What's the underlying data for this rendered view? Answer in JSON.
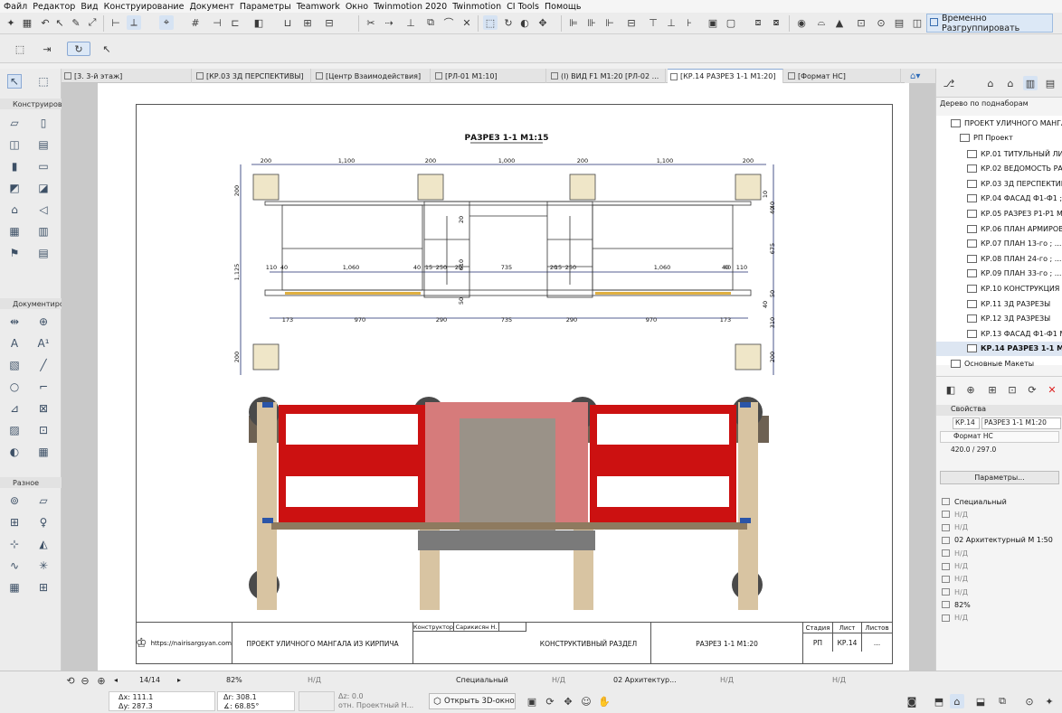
{
  "menubar": {
    "items": [
      "Файл",
      "Редактор",
      "Вид",
      "Конструирование",
      "Документ",
      "Параметры",
      "Teamwork",
      "Окно",
      "Twinmotion 2020",
      "Twinmotion",
      "CI Tools",
      "Помощь"
    ]
  },
  "toolbar": {
    "regroup_label": "Временно Разгруппировать"
  },
  "tabs": [
    {
      "label": "[3. 3-й этаж]"
    },
    {
      "label": "[КР.03 3Д ПЕРСПЕКТИВЫ]"
    },
    {
      "label": "[Центр Взаимодействия]"
    },
    {
      "label": "[РЛ-01 М1:10]"
    },
    {
      "label": "(I) ВИД F1 М1:20 [РЛ-02 ..."
    },
    {
      "label": "[КР.14 РАЗРЕЗ 1-1 М1:20]",
      "close": "×"
    },
    {
      "label": "[Формат НС]"
    }
  ],
  "toolbox": {
    "section1": "Конструирова",
    "section2": "Документиро",
    "section3": "Разное"
  },
  "drawing": {
    "title": "РАЗРЕЗ 1-1 М1:15",
    "dims_top": [
      "200",
      "1,100",
      "200",
      "1,000",
      "200",
      "1,100",
      "200"
    ],
    "dims_mid": [
      "110",
      "40",
      "1,060",
      "40",
      "15",
      "250",
      "20",
      "735",
      "20",
      "15",
      "250",
      "40",
      "1,060",
      "40",
      "110"
    ],
    "dims_bottom": [
      "173",
      "970",
      "290",
      "735",
      "290",
      "970",
      "173"
    ],
    "dims_left": [
      "200",
      "1,125",
      "200"
    ],
    "dims_right": [
      "40",
      "10",
      "40",
      "675",
      "50",
      "40",
      "310",
      "200"
    ],
    "dims_inner": [
      "20",
      "610",
      "50"
    ]
  },
  "title_block": {
    "site": "https://nairisargsyan.com",
    "project": "ПРОЕКТ УЛИЧНОГО МАНГАЛА ИЗ КИРПИЧА",
    "role_label": "Конструктор",
    "role_name": "Сарикисян Н.",
    "section": "КОНСТРУКТИВНЫЙ РАЗДЕЛ",
    "sheet_title": "РАЗРЕЗ 1-1 М1:20",
    "stage_label": "Стадия",
    "sheet_label": "Лист",
    "sheets_label": "Листов",
    "stage_value": "РП",
    "sheet_value": "КР.14",
    "sheets_value": "..."
  },
  "navigator": {
    "header": "Дерево по подн­аборам",
    "root": "ПРОЕКТ УЛИЧНОГО МАНГАЛ",
    "group": "РП Проект",
    "items": [
      "КР.01 ТИТУЛЬНЫЙ ЛИСТ",
      "КР.02 ВЕДОМОСТЬ РАБОЧИХ",
      "КР.03 3Д ПЕРСПЕКТИВЫ",
      "КР.04 ФАСАД Ф1-Ф1 ; ...",
      "КР.05 РАЗРЕЗ Р1-Р1 М...",
      "КР.06 ПЛАН АРМИРОВАНИЯ",
      "КР.07  ПЛАН 13-го ; ...",
      "КР.08  ПЛАН 24-го ; ...",
      "КР.09  ПЛАН 33-го ; ...",
      "КР.10 КОНСТРУКЦИЯ ...",
      "КР.11 3Д РАЗРЕЗЫ",
      "КР.12 3Д РАЗРЕЗЫ",
      "КР.13 ФАСАД Ф1-Ф1 М...",
      "КР.14 РАЗРЕЗ 1-1 М1..."
    ],
    "next_group": "Основные Макеты"
  },
  "properties": {
    "header": "Свойства",
    "id_value": "КР.14",
    "name_value": "РАЗРЕЗ 1-1 М1:20",
    "format": "Формат НС",
    "size": "420.0 / 297.0",
    "params_button": "Параметры...",
    "rows": [
      {
        "text": "Специальный",
        "dim": false
      },
      {
        "text": "Н/Д",
        "dim": true
      },
      {
        "text": "Н/Д",
        "dim": true
      },
      {
        "text": "02 Архитектурный М 1:50",
        "dim": false
      },
      {
        "text": "Н/Д",
        "dim": true
      },
      {
        "text": "Н/Д",
        "dim": true
      },
      {
        "text": "Н/Д",
        "dim": true
      },
      {
        "text": "Н/Д",
        "dim": true
      },
      {
        "text": "82%",
        "dim": false
      },
      {
        "text": "Н/Д",
        "dim": true
      }
    ]
  },
  "statusbar": {
    "page": "14/14",
    "zoom": "82%",
    "nd1": "Н/Д",
    "special": "Специальный",
    "nd2": "Н/Д",
    "arch": "02 Архитектур...",
    "nd3": "Н/Д",
    "nd4": "Н/Д",
    "dx": "Δx: 111.1",
    "dy": "Δy: 287.3",
    "dr": "Δr: 308.1",
    "da": "∡: 68.85°",
    "dz": "Δz: 0.0",
    "ref": "отн. Проектный Н...",
    "open3d": "Открыть 3D-окно"
  }
}
